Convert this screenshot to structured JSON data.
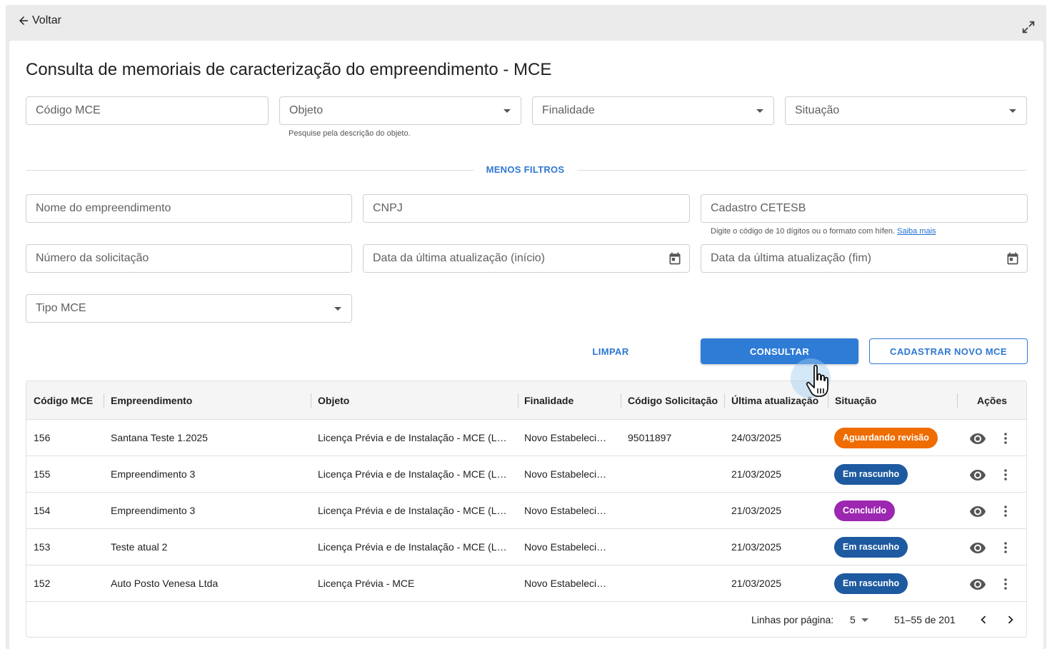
{
  "topbar": {
    "back_label": "Voltar"
  },
  "page": {
    "title": "Consulta de memoriais de caracterização do empreendimento - MCE"
  },
  "filters": {
    "codigo_mce": "Código MCE",
    "objeto": "Objeto",
    "objeto_hint": "Pesquise pela descrição do objeto.",
    "finalidade": "Finalidade",
    "situacao": "Situação",
    "toggle_label": "MENOS FILTROS",
    "nome_empreendimento": "Nome do empreendimento",
    "cnpj": "CNPJ",
    "cadastro_cetesb": "Cadastro CETESB",
    "cetesb_hint": "Digite o código de 10 dígitos ou o formato com hífen.",
    "cetesb_hint_link": "Saiba mais",
    "numero_solicitacao": "Número da solicitação",
    "data_inicio": "Data da última atualização (início)",
    "data_fim": "Data da última atualização (fim)",
    "tipo_mce": "Tipo MCE"
  },
  "actions": {
    "limpar": "LIMPAR",
    "consultar": "CONSULTAR",
    "cadastrar": "CADASTRAR NOVO MCE"
  },
  "table": {
    "columns": [
      "Código MCE",
      "Empreendimento",
      "Objeto",
      "Finalidade",
      "Código Solicitação",
      "Última atualização",
      "Situação",
      "Ações"
    ],
    "rows": [
      {
        "codigo": "156",
        "empreendimento": "Santana Teste 1.2025",
        "objeto": "Licença Prévia e de Instalação - MCE (LP/LI)",
        "finalidade": "Novo Estabelecimento",
        "solicitacao": "95011897",
        "atualizacao": "24/03/2025",
        "situacao": "Aguardando revisão",
        "situacao_color": "#ef6c00"
      },
      {
        "codigo": "155",
        "empreendimento": "Empreendimento 3",
        "objeto": "Licença Prévia e de Instalação - MCE (LP/LI)",
        "finalidade": "Novo Estabelecimento",
        "solicitacao": "",
        "atualizacao": "21/03/2025",
        "situacao": "Em rascunho",
        "situacao_color": "#1e5aa0"
      },
      {
        "codigo": "154",
        "empreendimento": "Empreendimento 3",
        "objeto": "Licença Prévia e de Instalação - MCE (LP/LI)",
        "finalidade": "Novo Estabelecimento",
        "solicitacao": "",
        "atualizacao": "21/03/2025",
        "situacao": "Concluído",
        "situacao_color": "#9c27b0"
      },
      {
        "codigo": "153",
        "empreendimento": "Teste atual 2",
        "objeto": "Licença Prévia e de Instalação - MCE (LP/LI)",
        "finalidade": "Novo Estabelecimento",
        "solicitacao": "",
        "atualizacao": "21/03/2025",
        "situacao": "Em rascunho",
        "situacao_color": "#1e5aa0"
      },
      {
        "codigo": "152",
        "empreendimento": "Auto Posto Venesa Ltda",
        "objeto": "Licença Prévia - MCE",
        "finalidade": "Novo Estabelecimento",
        "solicitacao": "",
        "atualizacao": "21/03/2025",
        "situacao": "Em rascunho",
        "situacao_color": "#1e5aa0"
      }
    ],
    "row_icons": [
      "eye-icon",
      "more-vert-icon"
    ]
  },
  "pagination": {
    "rows_per_page_label": "Linhas por página:",
    "rows_per_page_value": "5",
    "range": "51–55 de 201"
  },
  "colors": {
    "accent": "#2f7cd6",
    "link": "#2f78d2"
  }
}
